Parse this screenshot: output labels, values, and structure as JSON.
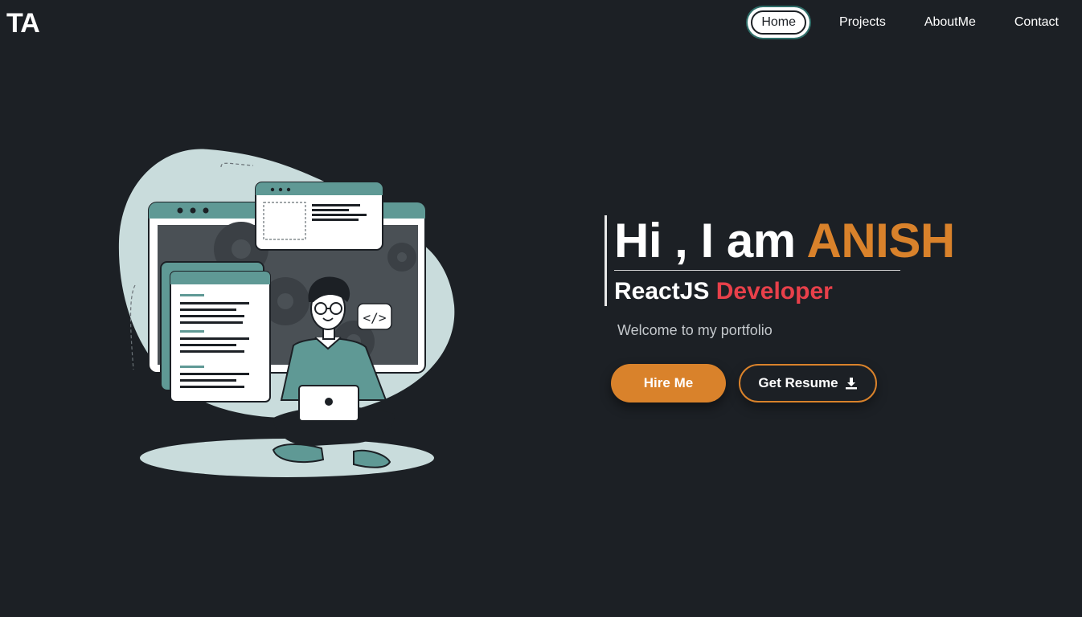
{
  "brand": {
    "logo": "TA"
  },
  "nav": {
    "items": [
      {
        "label": "Home",
        "active": true
      },
      {
        "label": "Projects",
        "active": false
      },
      {
        "label": "AboutMe",
        "active": false
      },
      {
        "label": "Contact",
        "active": false
      }
    ]
  },
  "hero": {
    "greeting": "Hi , I am ",
    "name": "ANISH",
    "role_prefix": "ReactJS ",
    "role_accent": "Developer",
    "welcome": "Welcome to my portfolio"
  },
  "actions": {
    "hire_label": "Hire Me",
    "resume_label": "Get Resume",
    "resume_icon": "download-icon"
  },
  "illustration": {
    "code_tag": "</>"
  },
  "colors": {
    "background": "#1c2025",
    "accent_orange": "#d9822b",
    "accent_red": "#e8404a",
    "teal": "#5f9995",
    "pale": "#c9dcdc"
  }
}
